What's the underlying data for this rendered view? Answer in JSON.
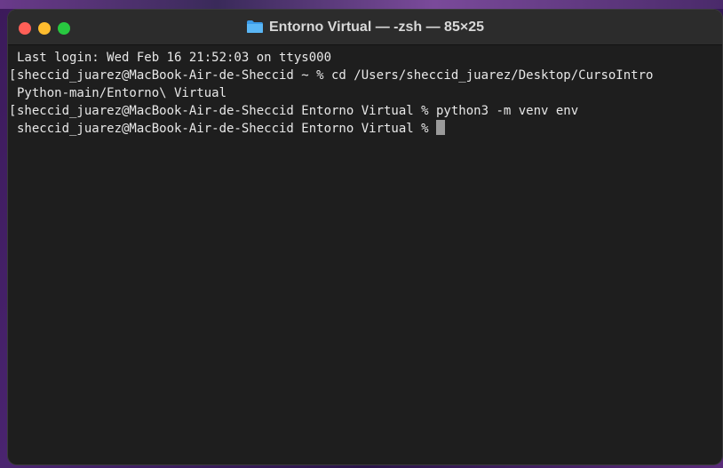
{
  "window": {
    "title": "Entorno Virtual — -zsh — 85×25",
    "folder_icon": "folder-icon",
    "folder_color": "#4aa8f0"
  },
  "traffic_lights": {
    "close_color": "#ff5f57",
    "minimize_color": "#febc2e",
    "maximize_color": "#28c840"
  },
  "terminal": {
    "lines": [
      "Last login: Wed Feb 16 21:52:03 on ttys000",
      "sheccid_juarez@MacBook-Air-de-Sheccid ~ % cd /Users/sheccid_juarez/Desktop/CursoIntro",
      "Python-main/Entorno\\ Virtual",
      "sheccid_juarez@MacBook-Air-de-Sheccid Entorno Virtual % python3 -m venv env",
      "sheccid_juarez@MacBook-Air-de-Sheccid Entorno Virtual % "
    ]
  }
}
